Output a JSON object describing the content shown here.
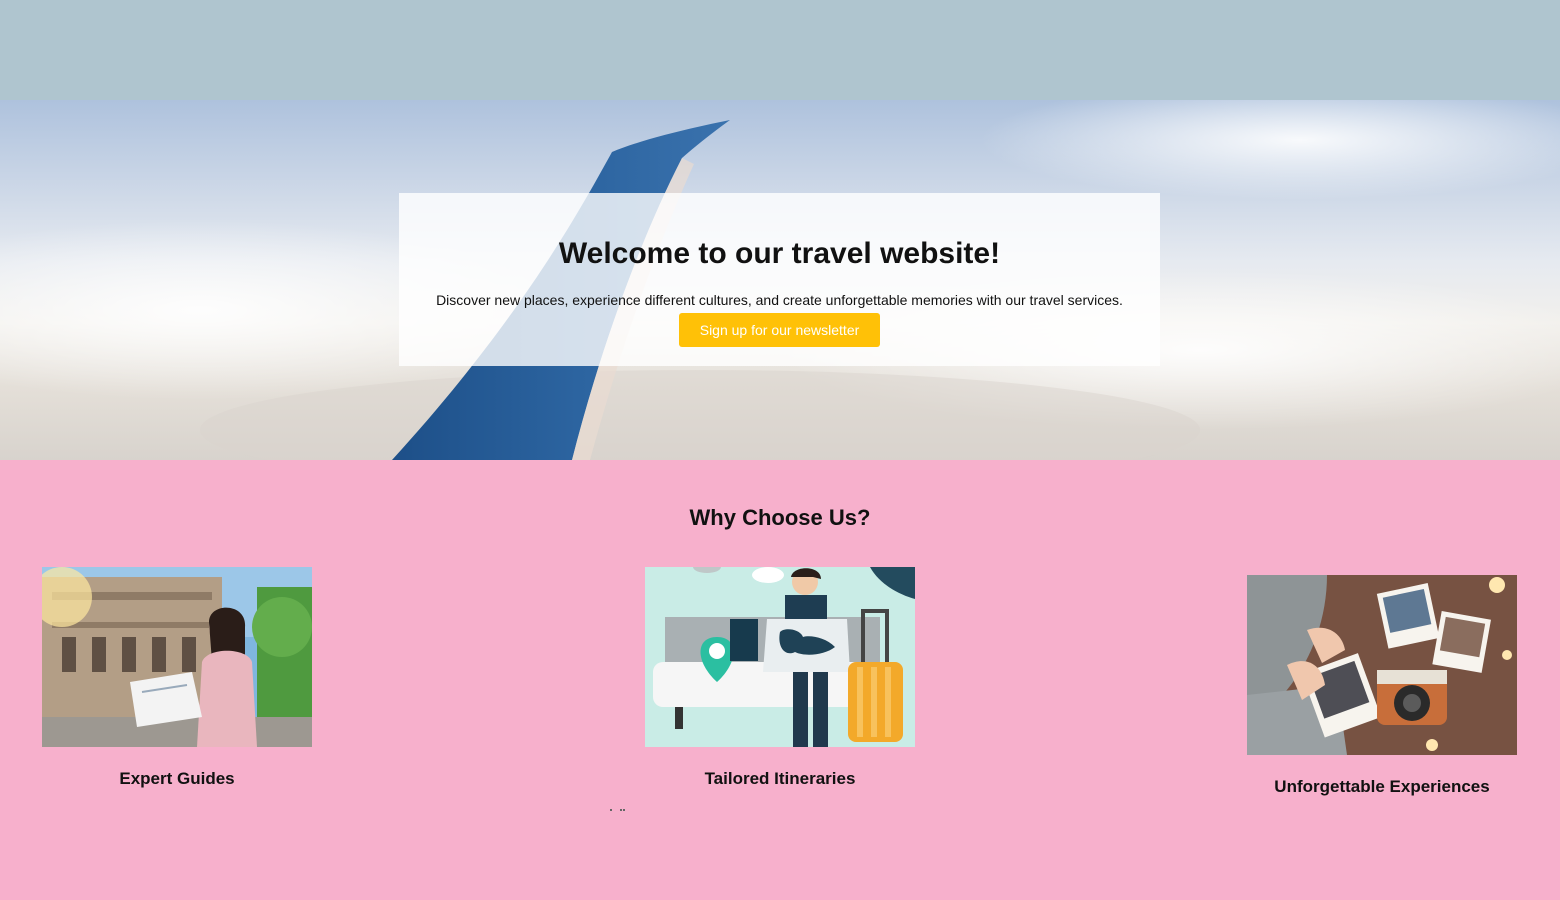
{
  "hero": {
    "title": "Welcome to our travel website!",
    "subtitle": "Discover new places, experience different cultures, and create unforgettable memories with our travel services.",
    "cta_label": "Sign up for our newsletter",
    "image": "airplane-wing-sky-photo"
  },
  "features": {
    "heading": "Why Choose Us?",
    "items": [
      {
        "label": "Expert Guides",
        "image": "woman-tourist-with-map-photo"
      },
      {
        "label": "Tailored Itineraries",
        "image": "traveler-with-map-and-suitcase-illustration"
      },
      {
        "label": "Unforgettable Experiences",
        "image": "instant-photos-and-camera-photo"
      }
    ]
  },
  "colors": {
    "top_bar": "#afc5cf",
    "features_bg": "#f7b0cc",
    "cta_bg": "#ffc107",
    "cta_text": "#ffffff"
  }
}
